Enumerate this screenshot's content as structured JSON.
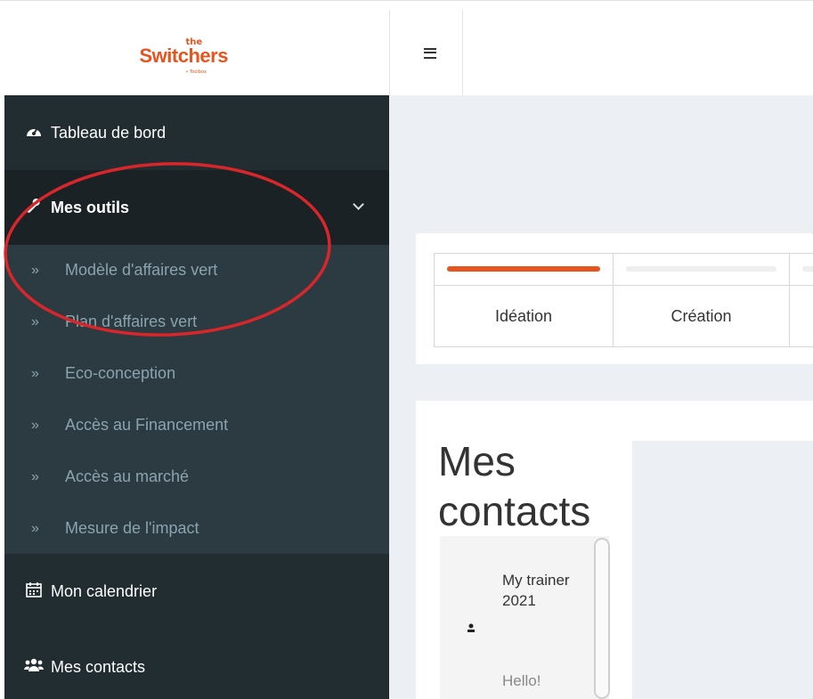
{
  "brand": {
    "logo_small": "the",
    "logo_main": "Switchers",
    "logo_sub": "• Toolbox"
  },
  "header": {
    "menu_icon": "hamburger-menu-icon"
  },
  "sidebar": {
    "items": [
      {
        "label": "Tableau de bord",
        "icon": "dashboard-gauge-icon"
      },
      {
        "label": "Mes outils",
        "icon": "wrench-icon",
        "expanded": true
      },
      {
        "label": "Mon calendrier",
        "icon": "calendar-icon"
      },
      {
        "label": "Mes contacts",
        "icon": "users-icon"
      }
    ],
    "submenu": [
      {
        "label": "Modèle d'affaires vert"
      },
      {
        "label": "Plan d'affaires vert"
      },
      {
        "label": "Eco-conception"
      },
      {
        "label": "Accès au Financement"
      },
      {
        "label": "Accès au marché"
      },
      {
        "label": "Mesure de l'impact"
      }
    ]
  },
  "progress": {
    "steps": [
      {
        "label": "Idéation",
        "progress": 1.0
      },
      {
        "label": "Création",
        "progress": 0.0
      },
      {
        "label": "",
        "progress": 0.0
      }
    ],
    "accent": "#e8541e"
  },
  "contacts": {
    "title": "Mes contacts",
    "items": [
      {
        "name": "My trainer 2021",
        "message": "Hello!"
      }
    ]
  },
  "colors": {
    "sidebar_bg": "#222d32",
    "submenu_bg": "#2c3b41",
    "annotation": "#d8262b"
  }
}
